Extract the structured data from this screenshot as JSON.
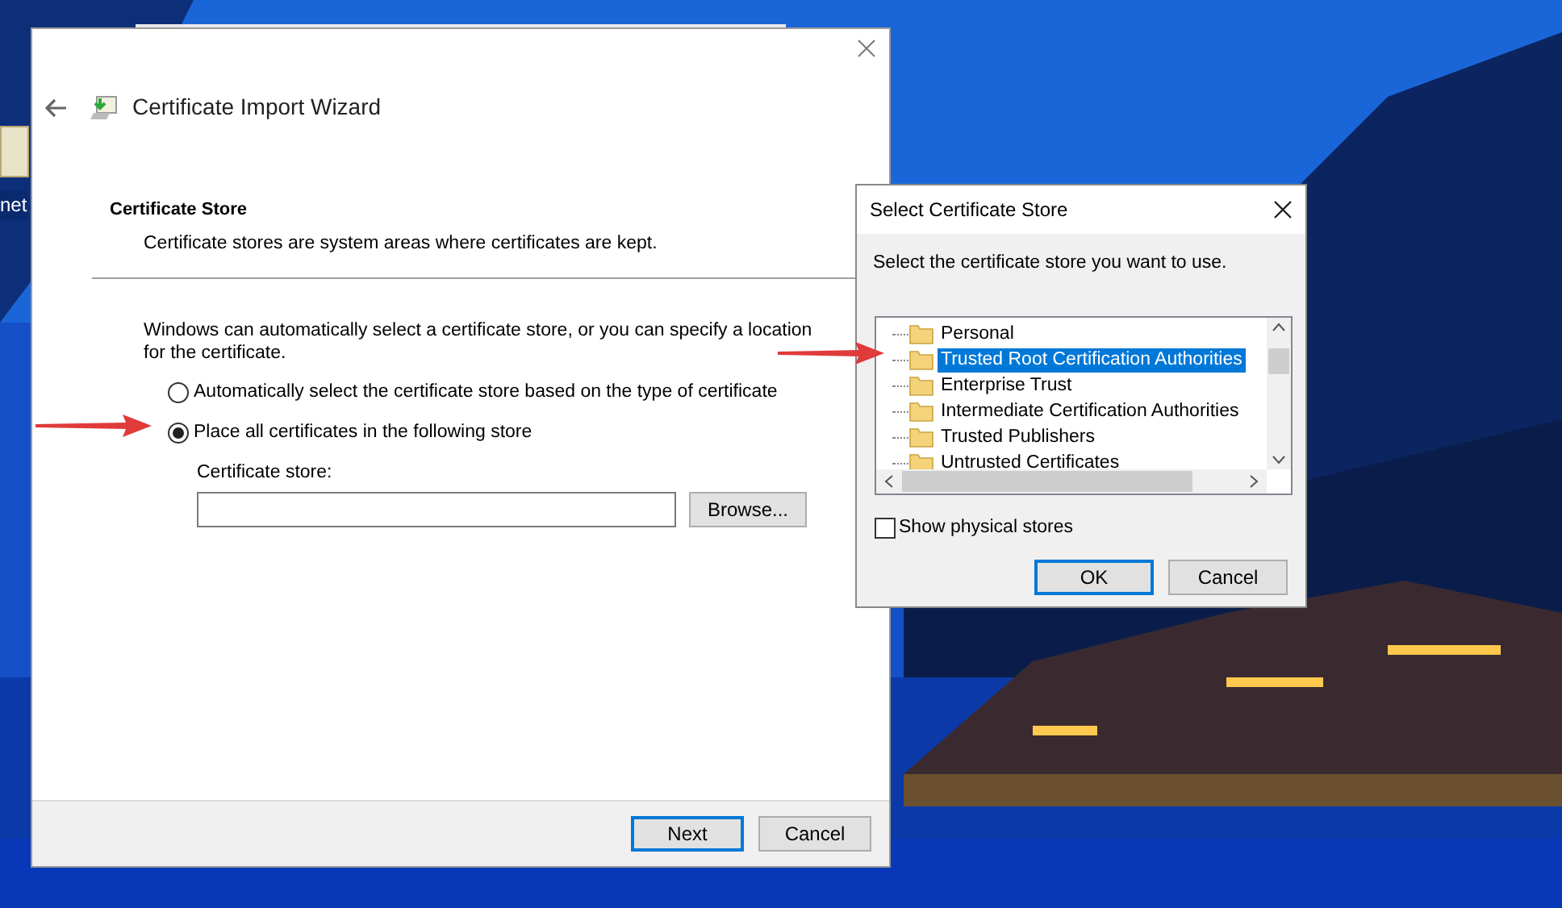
{
  "desktop": {
    "icon_label": "net"
  },
  "wizard": {
    "title": "Certificate Import Wizard",
    "section_title": "Certificate Store",
    "section_subtitle": "Certificate stores are system areas where certificates are kept.",
    "description": "Windows can automatically select a certificate store, or you can specify a location for the certificate.",
    "options": [
      {
        "label": "Automatically select the certificate store based on the type of certificate",
        "selected": false
      },
      {
        "label": "Place all certificates in the following store",
        "selected": true
      }
    ],
    "store_label": "Certificate store:",
    "browse_button": "Browse...",
    "buttons": [
      {
        "label": "Next",
        "default": true
      },
      {
        "label": "Cancel",
        "default": false
      }
    ]
  },
  "dialog": {
    "title": "Select Certificate Store",
    "prompt": "Select the certificate store you want to use.",
    "stores": [
      {
        "label": "Personal",
        "selected": false
      },
      {
        "label": "Trusted Root Certification Authorities",
        "selected": true
      },
      {
        "label": "Enterprise Trust",
        "selected": false
      },
      {
        "label": "Intermediate Certification Authorities",
        "selected": false
      },
      {
        "label": "Trusted Publishers",
        "selected": false
      },
      {
        "label": "Untrusted Certificates",
        "selected": false
      }
    ],
    "show_physical_stores": {
      "label": "Show physical stores",
      "checked": false
    },
    "buttons": [
      {
        "label": "OK",
        "default": true
      },
      {
        "label": "Cancel",
        "default": false
      }
    ]
  }
}
